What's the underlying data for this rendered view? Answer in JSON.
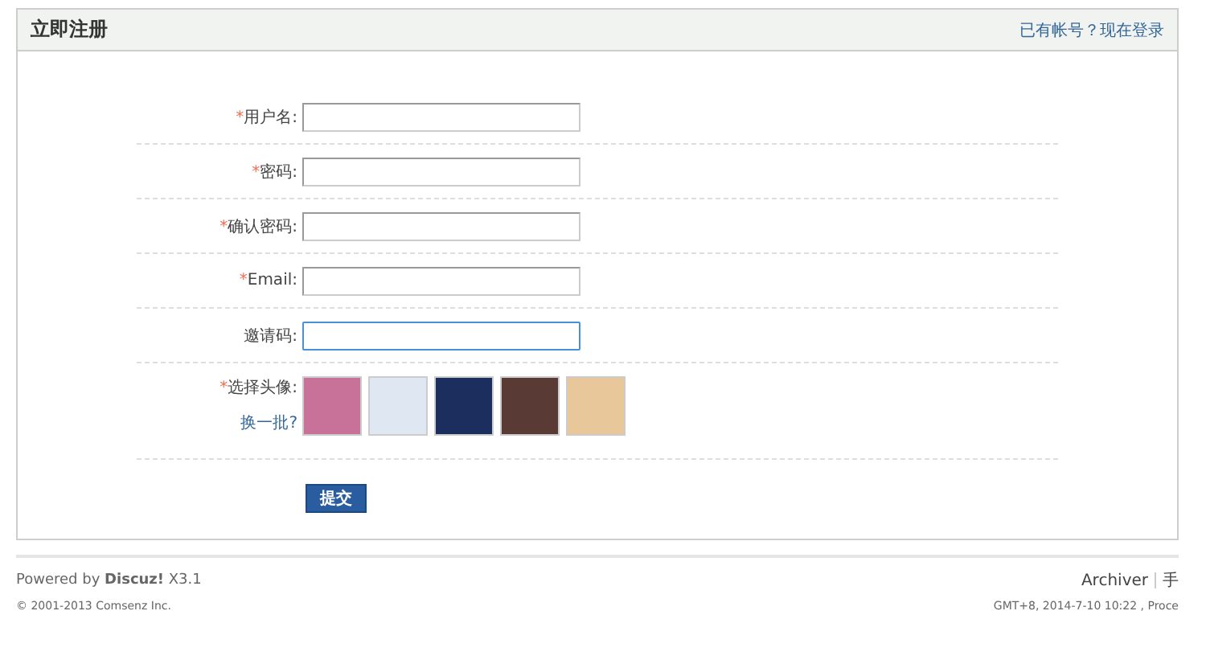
{
  "panel": {
    "title": "立即注册",
    "login_link": "已有帐号？现在登录"
  },
  "fields": [
    {
      "required_mark": "*",
      "label": "用户名:",
      "focused": false
    },
    {
      "required_mark": "*",
      "label": "密码:",
      "focused": false
    },
    {
      "required_mark": "*",
      "label": "确认密码:",
      "focused": false
    },
    {
      "required_mark": "*",
      "label": "Email:",
      "focused": false
    },
    {
      "label": "邀请码:",
      "focused": true
    }
  ],
  "avatar_picker": {
    "required_mark": "*",
    "label": "选择头像:",
    "refresh_link": "换一批?",
    "avatars": [
      {
        "color": "#c8729a"
      },
      {
        "color": "#dfe8f2"
      },
      {
        "color": "#1c2e5e"
      },
      {
        "color": "#5a3a34"
      },
      {
        "color": "#e8c89a"
      }
    ]
  },
  "submit_button": "提交",
  "footer": {
    "powered_prefix": "Powered by",
    "brand": "Discuz!",
    "version": "X3.1",
    "copyright": "© 2001-2013 Comsenz Inc.",
    "links": [
      "Archiver",
      "手"
    ],
    "time": "GMT+8, 2014-7-10 10:22 , Proce"
  }
}
